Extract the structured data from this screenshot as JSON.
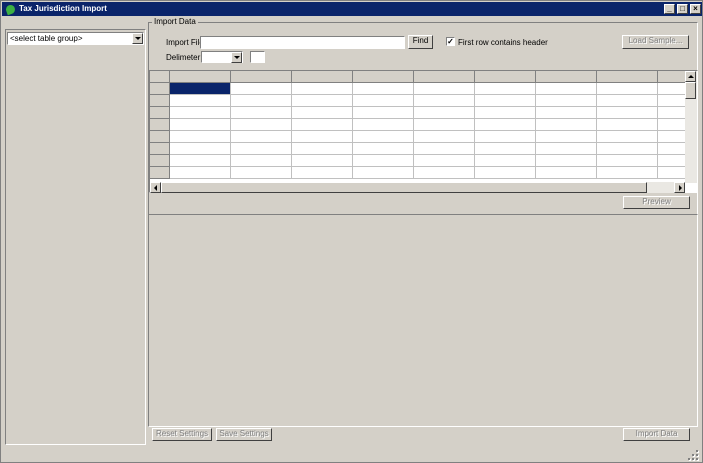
{
  "window": {
    "title": "Tax Jurisdiction Import"
  },
  "title_buttons": {
    "minimize": "_",
    "maximize": "□",
    "close": "×"
  },
  "left_panel": {
    "table_group_select": "<select table group>"
  },
  "import_data": {
    "group_label": "Import Data",
    "import_file_label": "Import File:",
    "import_file_value": "",
    "find_button": "Find",
    "first_row_header_checked": true,
    "first_row_header_mark": "✓",
    "first_row_header_label": "First row contains header",
    "load_sample_button": "Load Sample...",
    "delimiter_label": "Delimeter:",
    "delimiter_value": "",
    "delimiter_other_value": ""
  },
  "grid": {
    "columns": [
      "",
      "",
      "",
      "",
      "",
      "",
      "",
      "",
      ""
    ],
    "row_count": 8,
    "selected_cell": {
      "row": 1,
      "col": 1
    }
  },
  "buttons": {
    "preview": "Preview",
    "reset_settings": "Reset Settings",
    "save_settings": "Save Settings",
    "import_data": "Import Data"
  },
  "colors": {
    "title_bar": "#0a246a",
    "selection": "#0a246a",
    "face": "#d4d0c8"
  }
}
